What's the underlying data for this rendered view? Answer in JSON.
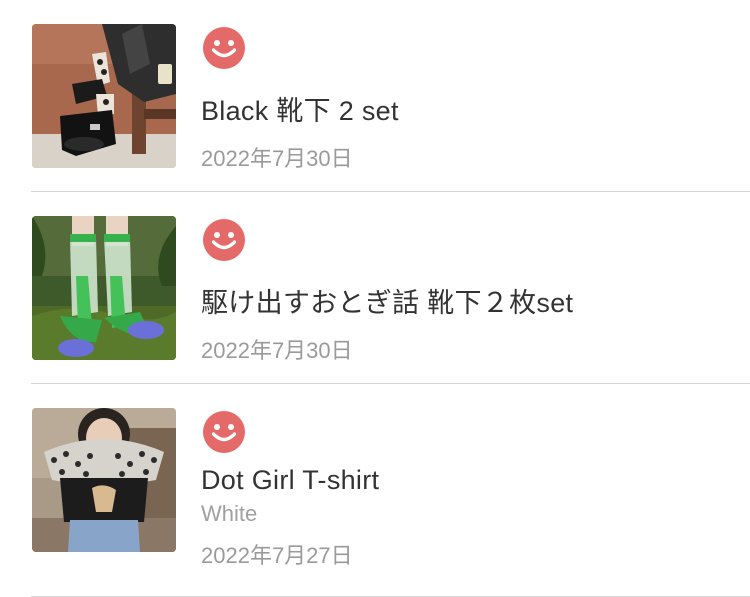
{
  "colors": {
    "rating_face": "#e46a6a",
    "title_text": "#333333",
    "secondary_text": "#9a9a9a",
    "divider": "#d6d6d6"
  },
  "items": [
    {
      "thumbnail": "product-photo-black-shoes-dotted-socks",
      "rating_icon": "smiley-face-icon",
      "title": "Black 靴下 2 set",
      "date": "2022年7月30日"
    },
    {
      "thumbnail": "product-photo-green-sheer-socks-on-moss",
      "rating_icon": "smiley-face-icon",
      "title": "駆け出すおとぎ話 靴下２枚set",
      "date": "2022年7月30日"
    },
    {
      "thumbnail": "product-photo-polka-dot-collar-t-shirt",
      "rating_icon": "smiley-face-icon",
      "title": "Dot  Girl  T-shirt",
      "variant": "White",
      "date": "2022年7月27日"
    }
  ]
}
